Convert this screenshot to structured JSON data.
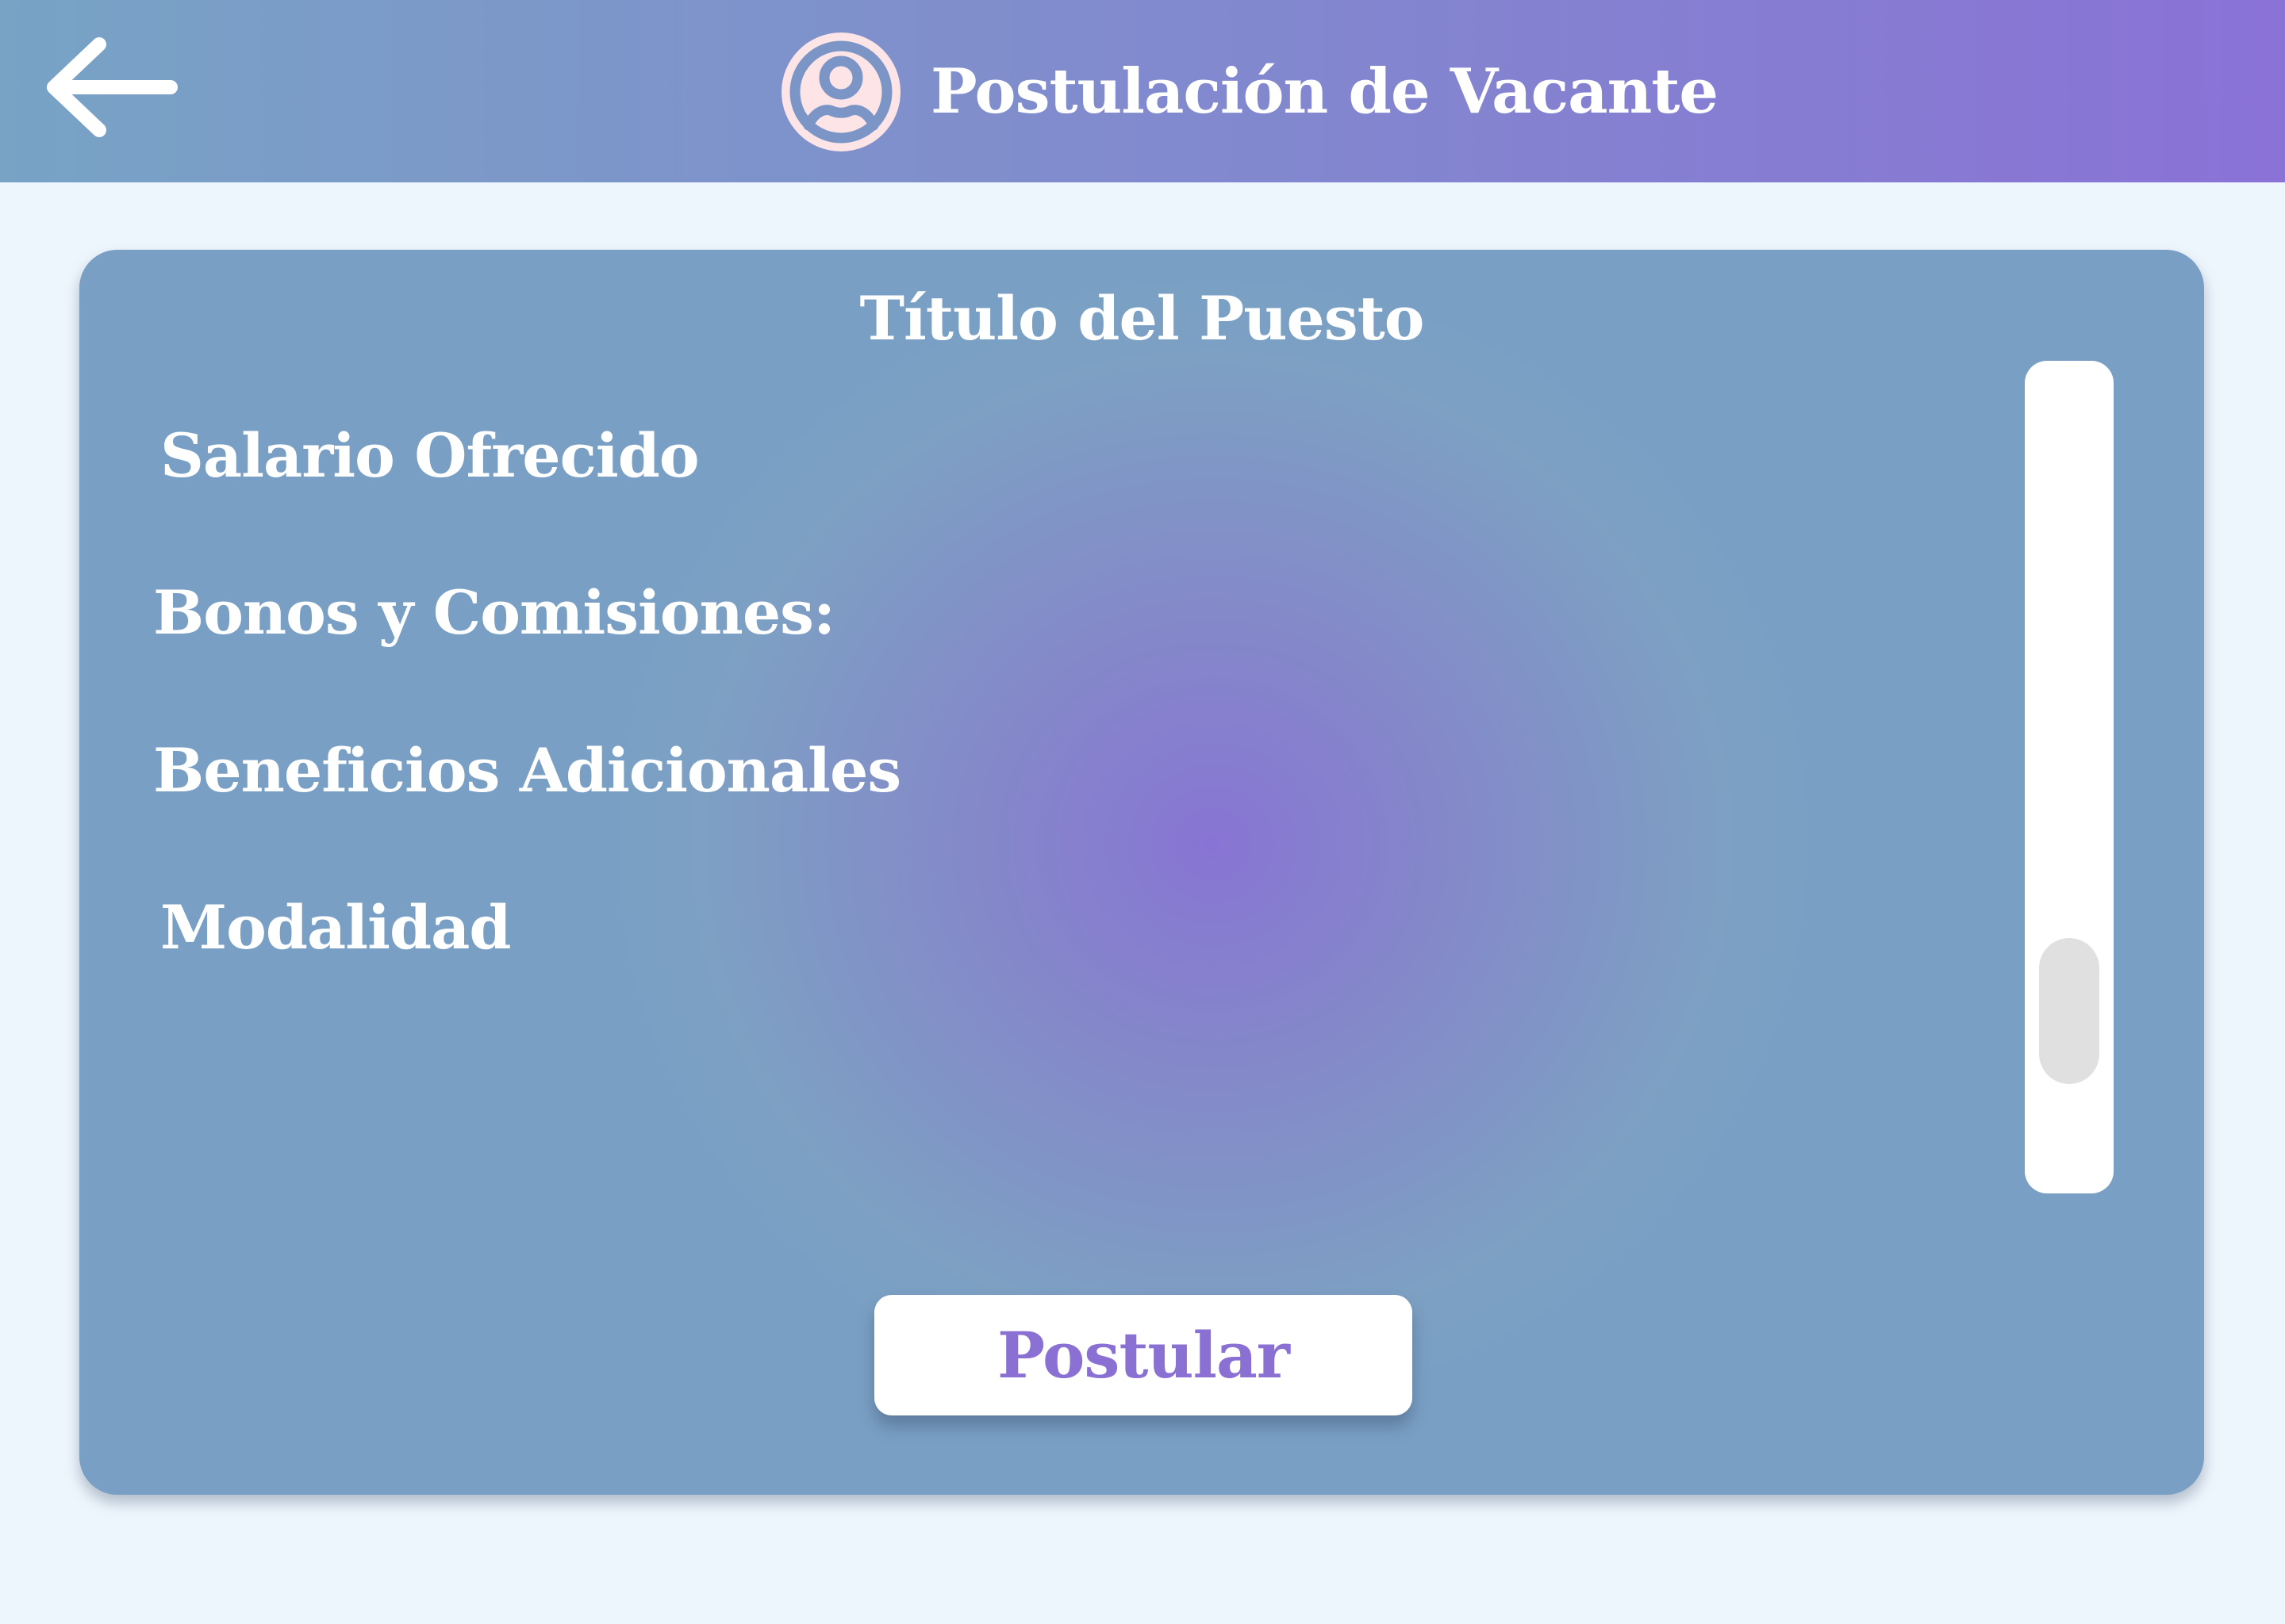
{
  "header": {
    "back_icon": "arrow-left-icon",
    "avatar_icon": "user-avatar-icon",
    "title": "Postulación de Vacante"
  },
  "card": {
    "title": "Título del Puesto",
    "fields": [
      "Salario Ofrecido",
      "Bonos y Comisiones:",
      "Beneficios Adicionales",
      "Modalidad"
    ],
    "apply_label": "Postular"
  },
  "colors": {
    "header_gradient_start": "#78a3c5",
    "header_gradient_end": "#8a72d6",
    "card_base": "#79a0c4",
    "card_center": "#8874d4",
    "accent": "#8a70d3",
    "page_background": "#eef6fd",
    "avatar_background": "#fde4e6"
  }
}
